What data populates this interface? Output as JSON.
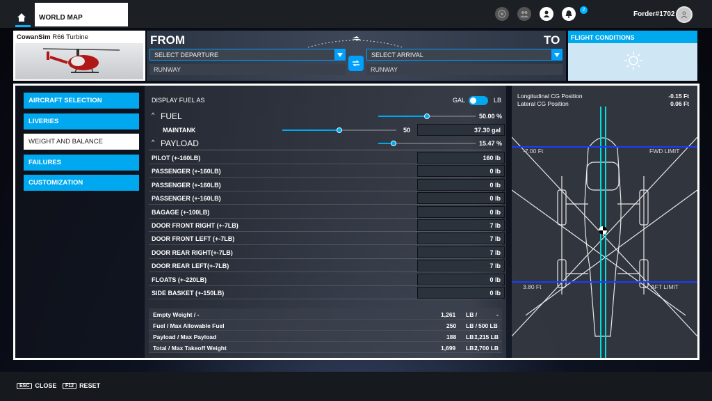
{
  "topbar": {
    "tab": "WORLD MAP",
    "notification_count": "2",
    "username": "Forder#1702"
  },
  "aircraft": {
    "brand": "CowanSim",
    "model": "R66 Turbine"
  },
  "route": {
    "from_label": "FROM",
    "to_label": "TO",
    "departure": "SELECT DEPARTURE",
    "arrival": "SELECT ARRIVAL",
    "departure_runway": "RUNWAY",
    "arrival_runway": "RUNWAY"
  },
  "conditions": {
    "title": "FLIGHT CONDITIONS"
  },
  "menu": [
    {
      "label": "AIRCRAFT SELECTION"
    },
    {
      "label": "LIVERIES"
    },
    {
      "label": "WEIGHT AND BALANCE"
    },
    {
      "label": "FAILURES"
    },
    {
      "label": "CUSTOMIZATION"
    }
  ],
  "fuel_display": {
    "label": "DISPLAY FUEL AS",
    "option_a": "GAL",
    "option_b": "LB",
    "selected": "GAL"
  },
  "fuel": {
    "title": "FUEL",
    "percent": "50.00 %",
    "fraction": 0.5
  },
  "maintank": {
    "label": "MAINTANK",
    "slider_value": "50",
    "value": "37.30 gal",
    "fraction": 0.5
  },
  "payload": {
    "title": "PAYLOAD",
    "percent": "15.47 %",
    "fraction": 0.1547
  },
  "payload_items": [
    {
      "label": "PILOT (+-160LB)",
      "value": "160 lb"
    },
    {
      "label": "PASSENGER (+-160LB)",
      "value": "0 lb"
    },
    {
      "label": "PASSENGER (+-160LB)",
      "value": "0 lb"
    },
    {
      "label": "PASSENGER (+-160LB)",
      "value": "0 lb"
    },
    {
      "label": "BAGAGE (+-100LB)",
      "value": "0 lb"
    },
    {
      "label": "DOOR FRONT RIGHT (+-7LB)",
      "value": "7 lb"
    },
    {
      "label": "DOOR FRONT LEFT (+-7LB)",
      "value": "7 lb"
    },
    {
      "label": "DOOR REAR RIGHT(+-7LB)",
      "value": "7 lb"
    },
    {
      "label": "DOOR REAR LEFT(+-7LB)",
      "value": "7 lb"
    },
    {
      "label": "FLOATS (+-220LB)",
      "value": "0 lb"
    },
    {
      "label": "SIDE BASKET (+-150LB)",
      "value": "0 lb"
    }
  ],
  "summary": [
    {
      "label": "Empty Weight / -",
      "value": "1,261",
      "unit": "LB /",
      "max": "-"
    },
    {
      "label": "Fuel / Max Allowable Fuel",
      "value": "250",
      "unit": "LB /",
      "max": "500 LB"
    },
    {
      "label": "Payload / Max Payload",
      "value": "188",
      "unit": "LB /",
      "max": "1,215 LB"
    },
    {
      "label": "Total / Max Takeoff Weight",
      "value": "1,699",
      "unit": "LB /",
      "max": "2,700 LB"
    }
  ],
  "cg": {
    "long_label": "Longitudinal CG Position",
    "long_value": "-0.15 Ft",
    "lat_label": "Lateral CG Position",
    "lat_value": "0.06 Ft",
    "fwd_value": "-7.00 Ft",
    "fwd_label": "FWD LIMIT",
    "aft_value": "3.80 Ft",
    "aft_label": "AFT LIMIT"
  },
  "footer": {
    "close_key": "ESC",
    "close_label": "CLOSE",
    "reset_key": "F12",
    "reset_label": "RESET"
  }
}
